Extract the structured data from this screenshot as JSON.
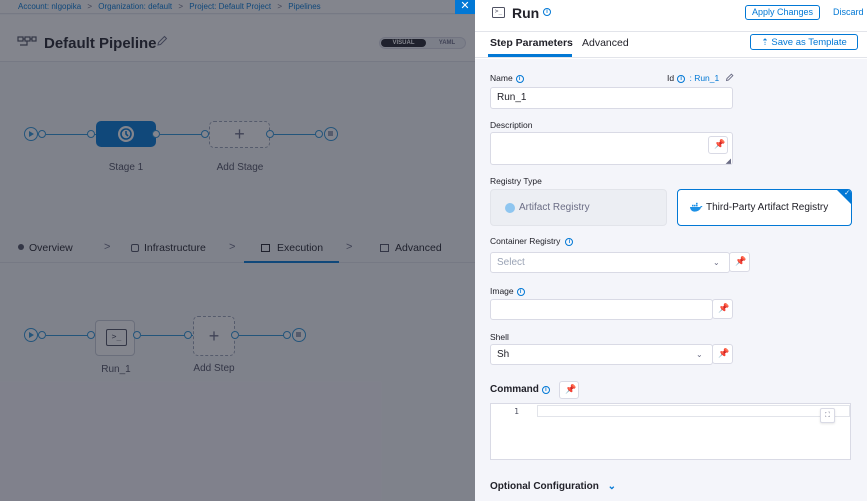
{
  "breadcrumb": {
    "items": [
      "Account: nlgopika",
      "Organization: default",
      "Project: Default Project",
      "Pipelines"
    ],
    "separator": ">"
  },
  "pipeline": {
    "title": "Default Pipeline",
    "view_visual": "VISUAL",
    "view_yaml": "YAML",
    "stage_label": "Stage 1",
    "add_stage_label": "Add Stage"
  },
  "stage_tabs": {
    "overview": "Overview",
    "infrastructure": "Infrastructure",
    "execution": "Execution",
    "advanced": "Advanced",
    "chevron": ">"
  },
  "execution": {
    "step_label": "Run_1",
    "add_step_label": "Add Step"
  },
  "panel": {
    "title": "Run",
    "apply_label": "Apply Changes",
    "discard_label": "Discard",
    "tab_step_params": "Step Parameters",
    "tab_advanced": "Advanced",
    "save_template_label": "Save as Template",
    "name_label": "Name",
    "id_label": "Id",
    "id_value": ": Run_1",
    "name_value": "Run_1",
    "description_label": "Description",
    "registry_type_label": "Registry Type",
    "registry_artifact": "Artifact Registry",
    "registry_third_party": "Third-Party Artifact Registry",
    "container_registry_label": "Container Registry",
    "container_registry_placeholder": "Select",
    "image_label": "Image",
    "shell_label": "Shell",
    "shell_value": "Sh",
    "command_label": "Command",
    "command_line_number": "1",
    "optional_config_label": "Optional Configuration"
  },
  "colors": {
    "accent": "#0278d5",
    "pipeline_line": "#2c94d8"
  }
}
